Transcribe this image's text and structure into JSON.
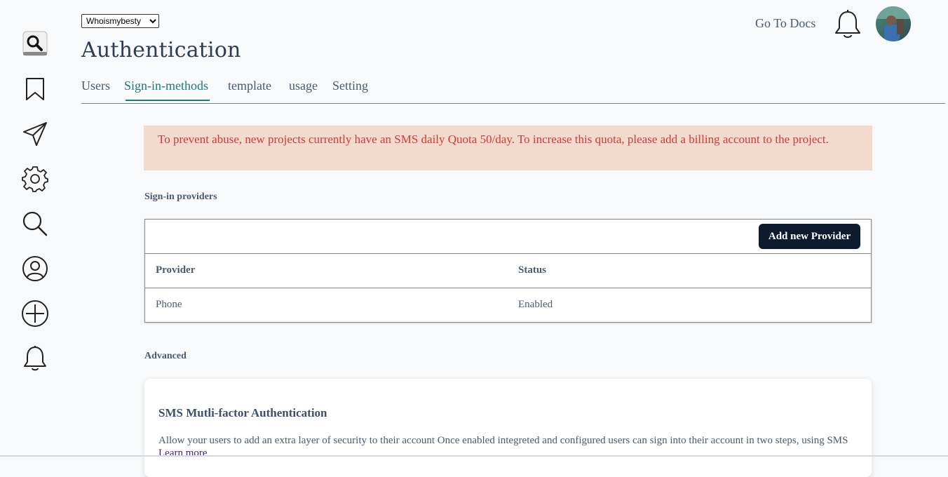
{
  "project_selector": {
    "selected": "Whoismybesty",
    "options": [
      "Whoismybesty"
    ]
  },
  "header": {
    "title": "Authentication",
    "docs_link": "Go To Docs"
  },
  "sidebar": {
    "icons": [
      "search-icon",
      "bookmark-icon",
      "send-icon",
      "gear-icon",
      "magnifier-icon",
      "user-icon",
      "plus-circle-icon",
      "bell-icon"
    ]
  },
  "tabs": [
    {
      "label": "Users",
      "active": false
    },
    {
      "label": "Sign-in-methods",
      "active": true
    },
    {
      "label": "template",
      "active": false
    },
    {
      "label": "usage",
      "active": false
    },
    {
      "label": "Setting",
      "active": false
    }
  ],
  "alert": {
    "text": "To prevent abuse, new projects currently have an SMS daily Quota 50/day. To increase this quota, please add a billing account to the project."
  },
  "providers": {
    "section_label": "Sign-in providers",
    "add_button": "Add new Provider",
    "columns": [
      "Provider",
      "Status"
    ],
    "rows": [
      {
        "provider": "Phone",
        "status": "Enabled"
      }
    ]
  },
  "advanced": {
    "section_label": "Advanced",
    "card_title": "SMS Mutli-factor Authentication",
    "description": "Allow your users to add an extra layer of security to their account Once enabled integreted and configured users can sign into their account in two steps, using SMS",
    "learn_more": "Learn more"
  },
  "colors": {
    "accent": "#1e7a73",
    "alert_bg": "#f2dacd",
    "alert_text": "#cf3a3a",
    "button_bg": "#0c1b2e"
  }
}
